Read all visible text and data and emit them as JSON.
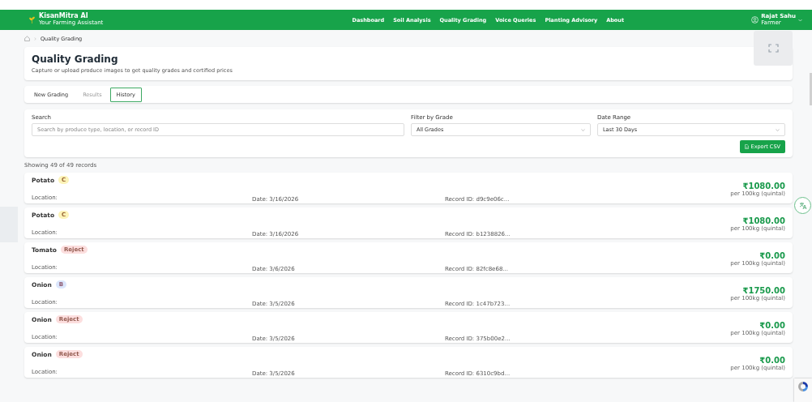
{
  "brand": {
    "name": "KisanMitra AI",
    "tagline": "Your Farming Assistant"
  },
  "nav": [
    "Dashboard",
    "Soil Analysis",
    "Quality Grading",
    "Voice Queries",
    "Planting Advisory",
    "About"
  ],
  "user": {
    "name": "Rajat Sahu",
    "role": "Farmer"
  },
  "breadcrumb": "Quality Grading",
  "header": {
    "title": "Quality Grading",
    "subtitle": "Capture or upload produce images to get quality grades and certified prices"
  },
  "tabs": [
    {
      "label": "New Grading",
      "selected": false,
      "disabled": false
    },
    {
      "label": "Results",
      "selected": false,
      "disabled": true
    },
    {
      "label": "History",
      "selected": true,
      "disabled": false
    }
  ],
  "filters": {
    "search": {
      "label": "Search",
      "placeholder": "Search by produce type, location, or record ID"
    },
    "grade": {
      "label": "Filter by Grade",
      "value": "All Grades"
    },
    "date": {
      "label": "Date Range",
      "value": "Last 30 Days"
    },
    "export": "Export CSV"
  },
  "summary": "Showing 49 of 49 records",
  "records": [
    {
      "name": "Potato",
      "grade": "C",
      "color": "#fcf3b8",
      "location": "Location:",
      "date": "Date: 3/16/2026",
      "record_id": "Record ID: d9c9e06c...",
      "price": "₹1080.00",
      "unit": "per 100kg (quintal)"
    },
    {
      "name": "Potato",
      "grade": "C",
      "color": "#fcf3b8",
      "location": "Location:",
      "date": "Date: 3/16/2026",
      "record_id": "Record ID: b1238826...",
      "price": "₹1080.00",
      "unit": "per 100kg (quintal)"
    },
    {
      "name": "Tomato",
      "grade": "Reject",
      "color": "#fcdede",
      "location": "Location:",
      "date": "Date: 3/6/2026",
      "record_id": "Record ID: 82fc8e68...",
      "price": "₹0.00",
      "unit": "per 100kg (quintal)"
    },
    {
      "name": "Onion",
      "grade": "B",
      "color": "#dbe6fc",
      "location": "Location:",
      "date": "Date: 3/5/2026",
      "record_id": "Record ID: 1c47b723...",
      "price": "₹1750.00",
      "unit": "per 100kg (quintal)"
    },
    {
      "name": "Onion",
      "grade": "Reject",
      "color": "#fcdede",
      "location": "Location:",
      "date": "Date: 3/5/2026",
      "record_id": "Record ID: 375b00e2...",
      "price": "₹0.00",
      "unit": "per 100kg (quintal)"
    },
    {
      "name": "Onion",
      "grade": "Reject",
      "color": "#fcdede",
      "location": "Location:",
      "date": "Date: 3/5/2026",
      "record_id": "Record ID: 6310c9bd...",
      "price": "₹0.00",
      "unit": "per 100kg (quintal)"
    }
  ]
}
